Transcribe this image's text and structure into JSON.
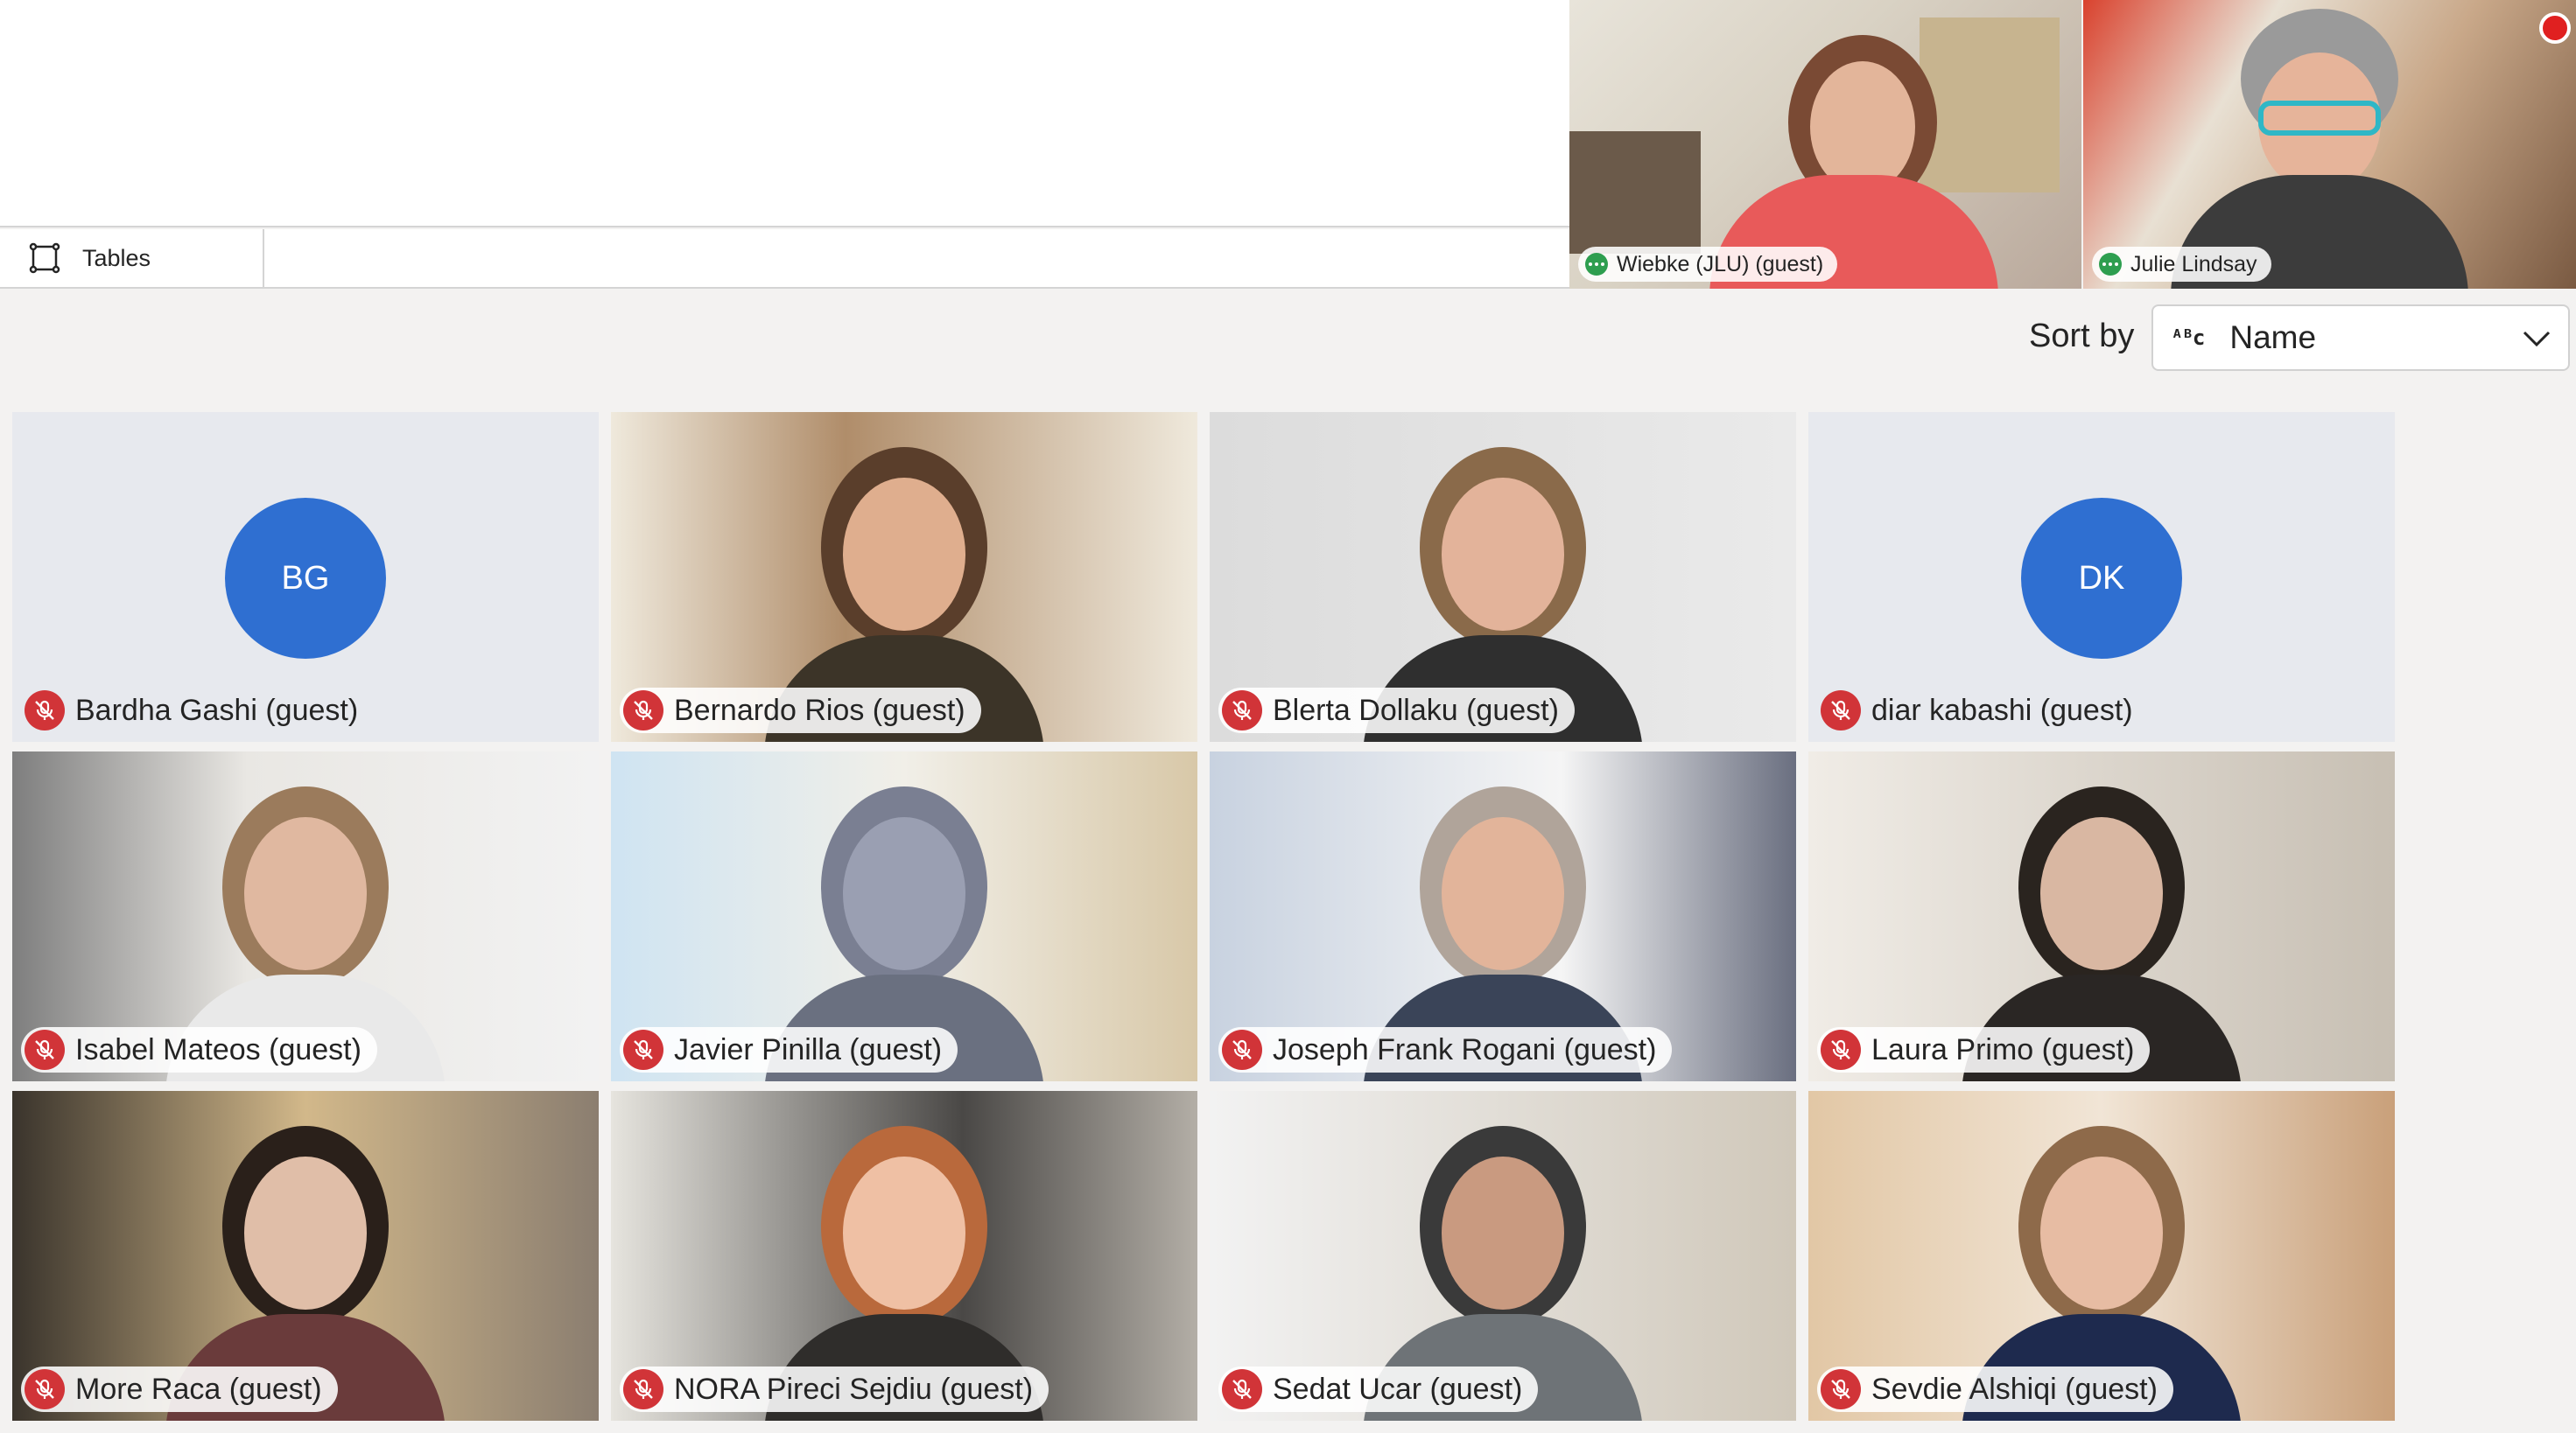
{
  "tabs": [
    {
      "label": "Tables"
    }
  ],
  "spotlight": [
    {
      "name": "Wiebke (JLU) (guest)"
    },
    {
      "name": "Julie Lindsay"
    }
  ],
  "sort": {
    "label": "Sort by",
    "icon": "abc-sort-icon",
    "value": "Name"
  },
  "participants": [
    {
      "name": "Bardha Gashi (guest)",
      "initials": "BG",
      "video": false
    },
    {
      "name": "Bernardo Rios (guest)",
      "video": true
    },
    {
      "name": "Blerta Dollaku (guest)",
      "video": true
    },
    {
      "name": "diar kabashi (guest)",
      "initials": "DK",
      "video": false
    },
    {
      "name": "Isabel Mateos (guest)",
      "video": true
    },
    {
      "name": "Javier Pinilla (guest)",
      "video": true
    },
    {
      "name": "Joseph Frank Rogani (guest)",
      "video": true
    },
    {
      "name": "Laura Primo (guest)",
      "video": true
    },
    {
      "name": "More Raca (guest)",
      "video": true
    },
    {
      "name": "NORA Pireci Sejdiu (guest)",
      "video": true
    },
    {
      "name": "Sedat Ucar (guest)",
      "video": true
    },
    {
      "name": "Sevdie Alshiqi (guest)",
      "video": true
    }
  ],
  "colors": {
    "avatar": "#2f6fd1",
    "mute": "#d13438",
    "recording": "#e02020",
    "active_speaker_dots": "#2e9e4f"
  }
}
